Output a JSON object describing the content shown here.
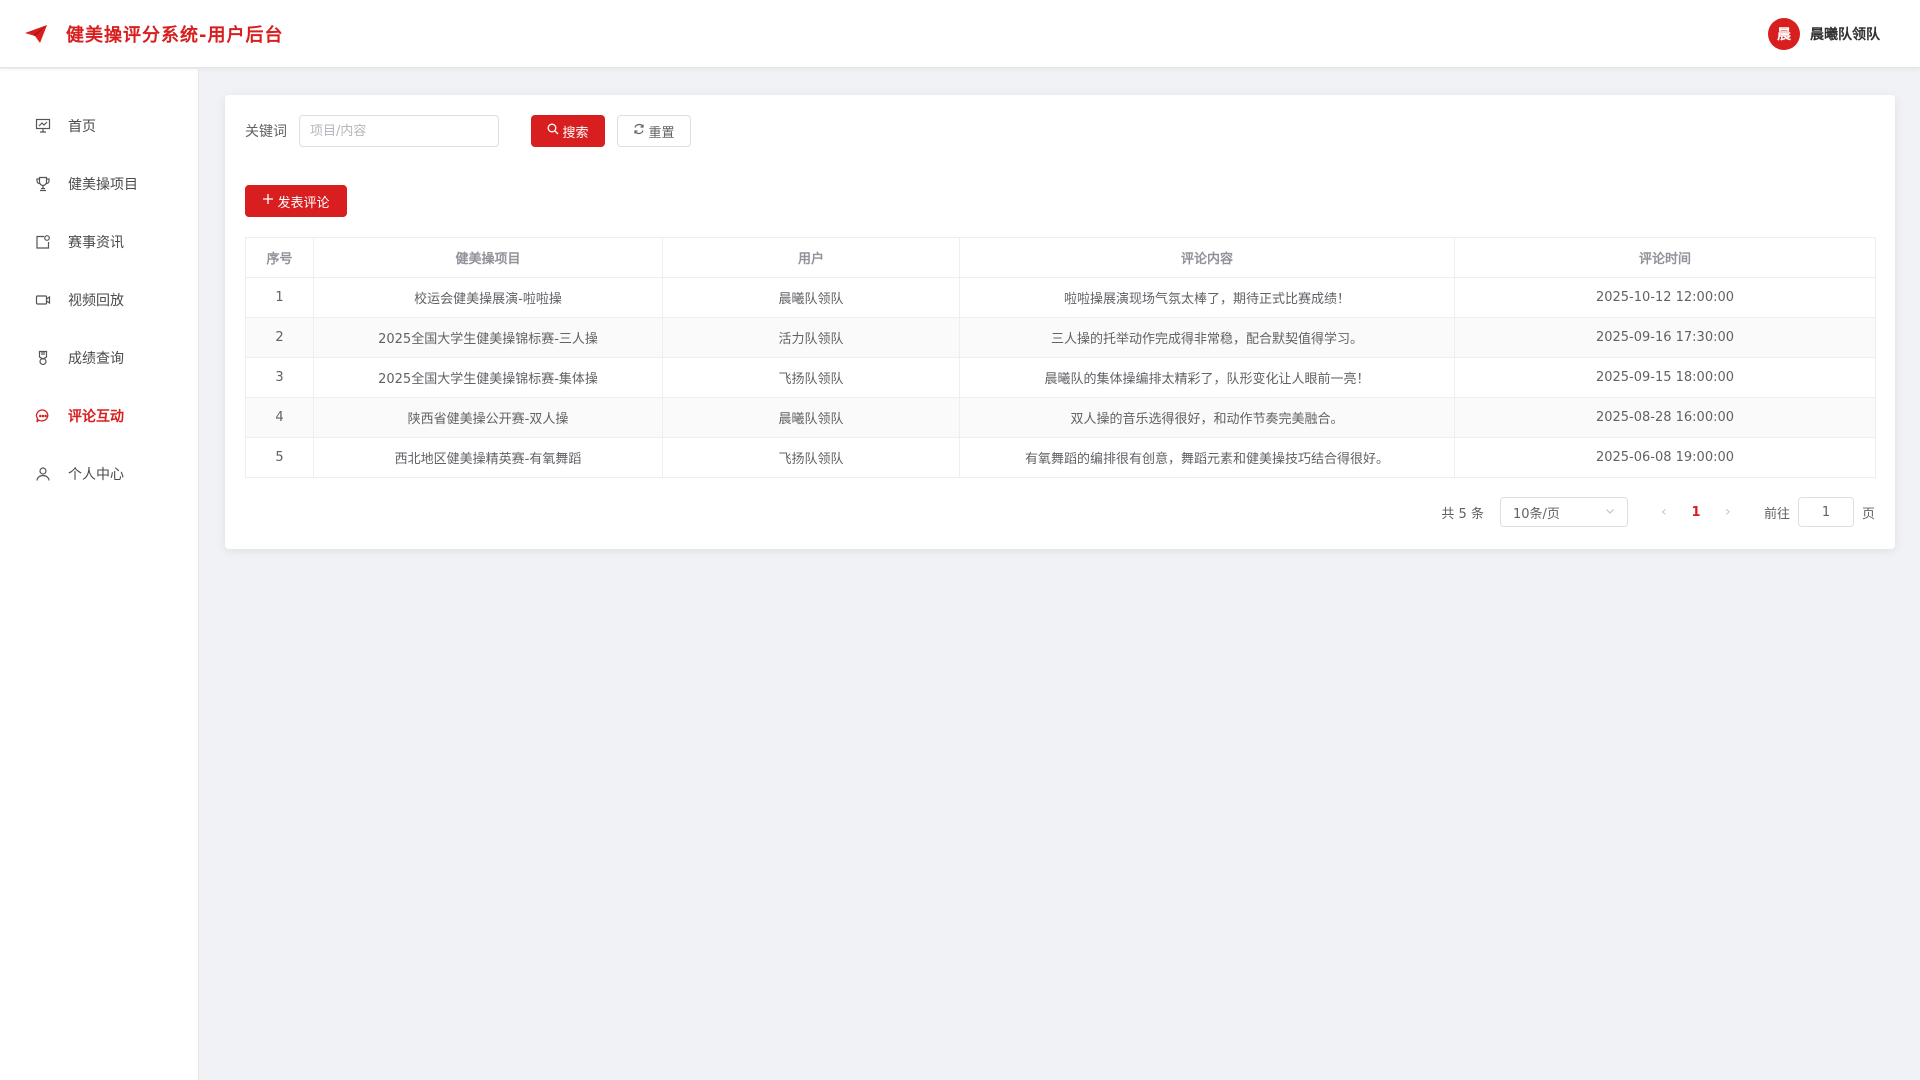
{
  "header": {
    "title": "健美操评分系统-用户后台",
    "brand_icon": "paper-plane-icon",
    "avatar_text": "晨",
    "user_name": "晨曦队领队",
    "accent_color": "#d81e1e"
  },
  "sidebar": {
    "items": [
      {
        "label": "首页",
        "icon": "dashboard-icon",
        "active": false
      },
      {
        "label": "健美操项目",
        "icon": "trophy-icon",
        "active": false
      },
      {
        "label": "赛事资讯",
        "icon": "news-icon",
        "active": false
      },
      {
        "label": "视频回放",
        "icon": "video-camera-icon",
        "active": false
      },
      {
        "label": "成绩查询",
        "icon": "medal-icon",
        "active": false
      },
      {
        "label": "评论互动",
        "icon": "chat-icon",
        "active": true
      },
      {
        "label": "个人中心",
        "icon": "user-icon",
        "active": false
      }
    ]
  },
  "search": {
    "label": "关键词",
    "placeholder": "项目/内容",
    "value": "",
    "search_button": "搜索",
    "reset_button": "重置"
  },
  "actions": {
    "add_button": "发表评论"
  },
  "table": {
    "headers": [
      "序号",
      "健美操项目",
      "用户",
      "评论内容",
      "评论时间"
    ],
    "rows": [
      [
        "1",
        "校运会健美操展演-啦啦操",
        "晨曦队领队",
        "啦啦操展演现场气氛太棒了，期待正式比赛成绩！",
        "2025-10-12 12:00:00"
      ],
      [
        "2",
        "2025全国大学生健美操锦标赛-三人操",
        "活力队领队",
        "三人操的托举动作完成得非常稳，配合默契值得学习。",
        "2025-09-16 17:30:00"
      ],
      [
        "3",
        "2025全国大学生健美操锦标赛-集体操",
        "飞扬队领队",
        "晨曦队的集体操编排太精彩了，队形变化让人眼前一亮！",
        "2025-09-15 18:00:00"
      ],
      [
        "4",
        "陕西省健美操公开赛-双人操",
        "晨曦队领队",
        "双人操的音乐选得很好，和动作节奏完美融合。",
        "2025-08-28 16:00:00"
      ],
      [
        "5",
        "西北地区健美操精英赛-有氧舞蹈",
        "飞扬队领队",
        "有氧舞蹈的编排很有创意，舞蹈元素和健美操技巧结合得很好。",
        "2025-06-08 19:00:00"
      ]
    ]
  },
  "pagination": {
    "total_text": "共 5 条",
    "page_size": "10条/页",
    "current_page": "1",
    "goto_label": "前往",
    "goto_value": "1",
    "page_unit": "页"
  }
}
